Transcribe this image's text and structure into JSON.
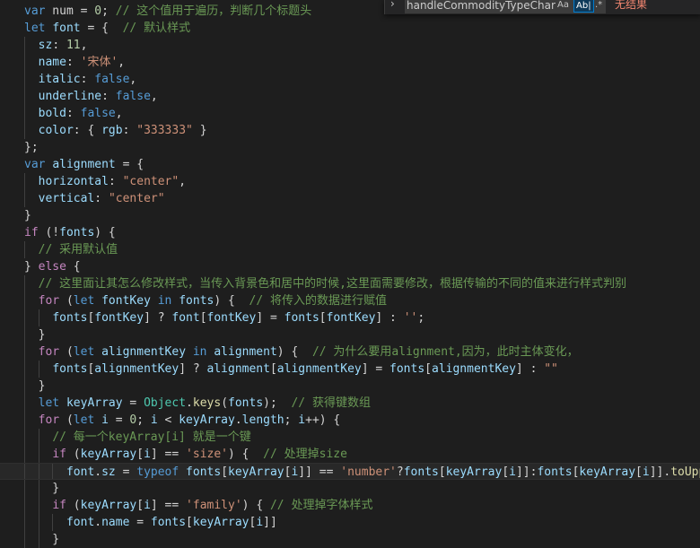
{
  "colors": {
    "background": "#1e1e1e",
    "keyword": "#569cd6",
    "control": "#c586c0",
    "variable": "#9cdcfe",
    "number": "#b5cea8",
    "string": "#ce9178",
    "comment": "#6a9955",
    "function": "#dcdcaa",
    "class": "#4ec9b0",
    "no_results": "#f48771"
  },
  "find_widget": {
    "toggle_icon": "chevron-right-icon",
    "query": "handleCommodityTypeChar",
    "match_case_label": "Aa",
    "whole_word_label": "Ab|",
    "regex_label": ".*",
    "result_text": "无结果"
  },
  "editor": {
    "lines": [
      [
        [
          "kw",
          "var"
        ],
        [
          "p",
          " num = "
        ],
        [
          "n",
          "0"
        ],
        [
          "p",
          "; "
        ],
        [
          "c",
          "// 这个值用于遍历，判断几个标题头"
        ]
      ],
      [
        [
          "kw",
          "let"
        ],
        [
          "p",
          " "
        ],
        [
          "v",
          "font"
        ],
        [
          "p",
          " = {  "
        ],
        [
          "c",
          "// 默认样式"
        ]
      ],
      [
        [
          "p",
          "  "
        ],
        [
          "v",
          "sz"
        ],
        [
          "p",
          ": "
        ],
        [
          "n",
          "11"
        ],
        [
          "p",
          ","
        ]
      ],
      [
        [
          "p",
          "  "
        ],
        [
          "v",
          "name"
        ],
        [
          "p",
          ": "
        ],
        [
          "s",
          "'宋体'"
        ],
        [
          "p",
          ","
        ]
      ],
      [
        [
          "p",
          "  "
        ],
        [
          "v",
          "italic"
        ],
        [
          "p",
          ": "
        ],
        [
          "kw",
          "false"
        ],
        [
          "p",
          ","
        ]
      ],
      [
        [
          "p",
          "  "
        ],
        [
          "v",
          "underline"
        ],
        [
          "p",
          ": "
        ],
        [
          "kw",
          "false"
        ],
        [
          "p",
          ","
        ]
      ],
      [
        [
          "p",
          "  "
        ],
        [
          "v",
          "bold"
        ],
        [
          "p",
          ": "
        ],
        [
          "kw",
          "false"
        ],
        [
          "p",
          ","
        ]
      ],
      [
        [
          "p",
          "  "
        ],
        [
          "v",
          "color"
        ],
        [
          "p",
          ": { "
        ],
        [
          "v",
          "rgb"
        ],
        [
          "p",
          ": "
        ],
        [
          "s",
          "\"333333\""
        ],
        [
          "p",
          " }"
        ]
      ],
      [
        [
          "p",
          "};"
        ]
      ],
      [
        [
          "kw",
          "var"
        ],
        [
          "p",
          " "
        ],
        [
          "v",
          "alignment"
        ],
        [
          "p",
          " = {"
        ]
      ],
      [
        [
          "p",
          "  "
        ],
        [
          "v",
          "horizontal"
        ],
        [
          "p",
          ": "
        ],
        [
          "s",
          "\"center\""
        ],
        [
          "p",
          ","
        ]
      ],
      [
        [
          "p",
          "  "
        ],
        [
          "v",
          "vertical"
        ],
        [
          "p",
          ": "
        ],
        [
          "s",
          "\"center\""
        ]
      ],
      [
        [
          "p",
          "}"
        ]
      ],
      [
        [
          "ct",
          "if"
        ],
        [
          "p",
          " (!"
        ],
        [
          "v",
          "fonts"
        ],
        [
          "p",
          ") {"
        ]
      ],
      [
        [
          "p",
          "  "
        ],
        [
          "c",
          "// 采用默认值"
        ]
      ],
      [
        [
          "p",
          "} "
        ],
        [
          "ct",
          "else"
        ],
        [
          "p",
          " {"
        ]
      ],
      [
        [
          "p",
          "  "
        ],
        [
          "c",
          "// 这里面让其怎么修改样式，当传入背景色和居中的时候,这里面需要修改，根据传输的不同的值来进行样式判别"
        ]
      ],
      [
        [
          "p",
          "  "
        ],
        [
          "ct",
          "for"
        ],
        [
          "p",
          " ("
        ],
        [
          "kw",
          "let"
        ],
        [
          "p",
          " "
        ],
        [
          "v",
          "fontKey"
        ],
        [
          "p",
          " "
        ],
        [
          "kw",
          "in"
        ],
        [
          "p",
          " "
        ],
        [
          "v",
          "fonts"
        ],
        [
          "p",
          ") {  "
        ],
        [
          "c",
          "// 将传入的数据进行赋值"
        ]
      ],
      [
        [
          "p",
          "    "
        ],
        [
          "v",
          "fonts"
        ],
        [
          "p",
          "["
        ],
        [
          "v",
          "fontKey"
        ],
        [
          "p",
          "] ? "
        ],
        [
          "v",
          "font"
        ],
        [
          "p",
          "["
        ],
        [
          "v",
          "fontKey"
        ],
        [
          "p",
          "] = "
        ],
        [
          "v",
          "fonts"
        ],
        [
          "p",
          "["
        ],
        [
          "v",
          "fontKey"
        ],
        [
          "p",
          "] : "
        ],
        [
          "s",
          "''"
        ],
        [
          "p",
          ";"
        ]
      ],
      [
        [
          "p",
          "  }"
        ]
      ],
      [
        [
          "p",
          "  "
        ],
        [
          "ct",
          "for"
        ],
        [
          "p",
          " ("
        ],
        [
          "kw",
          "let"
        ],
        [
          "p",
          " "
        ],
        [
          "v",
          "alignmentKey"
        ],
        [
          "p",
          " "
        ],
        [
          "kw",
          "in"
        ],
        [
          "p",
          " "
        ],
        [
          "v",
          "alignment"
        ],
        [
          "p",
          ") {  "
        ],
        [
          "c",
          "// 为什么要用alignment,因为，此时主体变化，"
        ]
      ],
      [
        [
          "p",
          "    "
        ],
        [
          "v",
          "fonts"
        ],
        [
          "p",
          "["
        ],
        [
          "v",
          "alignmentKey"
        ],
        [
          "p",
          "] ? "
        ],
        [
          "v",
          "alignment"
        ],
        [
          "p",
          "["
        ],
        [
          "v",
          "alignmentKey"
        ],
        [
          "p",
          "] = "
        ],
        [
          "v",
          "fonts"
        ],
        [
          "p",
          "["
        ],
        [
          "v",
          "alignmentKey"
        ],
        [
          "p",
          "] : "
        ],
        [
          "s",
          "\"\""
        ]
      ],
      [
        [
          "p",
          "  }"
        ]
      ],
      [
        [
          "p",
          "  "
        ],
        [
          "kw",
          "let"
        ],
        [
          "p",
          " "
        ],
        [
          "v",
          "keyArray"
        ],
        [
          "p",
          " = "
        ],
        [
          "cl",
          "Object"
        ],
        [
          "p",
          "."
        ],
        [
          "f",
          "keys"
        ],
        [
          "p",
          "("
        ],
        [
          "v",
          "fonts"
        ],
        [
          "p",
          ");  "
        ],
        [
          "c",
          "// 获得键数组"
        ]
      ],
      [
        [
          "p",
          "  "
        ],
        [
          "ct",
          "for"
        ],
        [
          "p",
          " ("
        ],
        [
          "kw",
          "let"
        ],
        [
          "p",
          " "
        ],
        [
          "v",
          "i"
        ],
        [
          "p",
          " = "
        ],
        [
          "n",
          "0"
        ],
        [
          "p",
          "; "
        ],
        [
          "v",
          "i"
        ],
        [
          "p",
          " < "
        ],
        [
          "v",
          "keyArray"
        ],
        [
          "p",
          "."
        ],
        [
          "v",
          "length"
        ],
        [
          "p",
          "; "
        ],
        [
          "v",
          "i"
        ],
        [
          "p",
          "++) {"
        ]
      ],
      [
        [
          "p",
          "    "
        ],
        [
          "c",
          "// 每一个keyArray[i] 就是一个键"
        ]
      ],
      [
        [
          "p",
          "    "
        ],
        [
          "ct",
          "if"
        ],
        [
          "p",
          " ("
        ],
        [
          "v",
          "keyArray"
        ],
        [
          "p",
          "["
        ],
        [
          "v",
          "i"
        ],
        [
          "p",
          "] == "
        ],
        [
          "s",
          "'size'"
        ],
        [
          "p",
          ") {  "
        ],
        [
          "c",
          "// 处理掉size"
        ]
      ],
      [
        [
          "p",
          "      "
        ],
        [
          "v",
          "font"
        ],
        [
          "p",
          "."
        ],
        [
          "v",
          "sz"
        ],
        [
          "p",
          " = "
        ],
        [
          "kw",
          "typeof"
        ],
        [
          "p",
          " "
        ],
        [
          "v",
          "fonts"
        ],
        [
          "p",
          "["
        ],
        [
          "v",
          "keyArray"
        ],
        [
          "p",
          "["
        ],
        [
          "v",
          "i"
        ],
        [
          "p",
          "]] == "
        ],
        [
          "s",
          "'number'"
        ],
        [
          "p",
          "?"
        ],
        [
          "v",
          "fonts"
        ],
        [
          "p",
          "["
        ],
        [
          "v",
          "keyArray"
        ],
        [
          "p",
          "["
        ],
        [
          "v",
          "i"
        ],
        [
          "p",
          "]]:"
        ],
        [
          "v",
          "fonts"
        ],
        [
          "p",
          "["
        ],
        [
          "v",
          "keyArray"
        ],
        [
          "p",
          "["
        ],
        [
          "v",
          "i"
        ],
        [
          "p",
          "]]."
        ],
        [
          "f",
          "toUpperCase"
        ]
      ],
      [
        [
          "p",
          "    }"
        ]
      ],
      [
        [
          "p",
          "    "
        ],
        [
          "ct",
          "if"
        ],
        [
          "p",
          " ("
        ],
        [
          "v",
          "keyArray"
        ],
        [
          "p",
          "["
        ],
        [
          "v",
          "i"
        ],
        [
          "p",
          "] == "
        ],
        [
          "s",
          "'family'"
        ],
        [
          "p",
          ") { "
        ],
        [
          "c",
          "// 处理掉字体样式"
        ]
      ],
      [
        [
          "p",
          "      "
        ],
        [
          "v",
          "font"
        ],
        [
          "p",
          "."
        ],
        [
          "v",
          "name"
        ],
        [
          "p",
          " = "
        ],
        [
          "v",
          "fonts"
        ],
        [
          "p",
          "["
        ],
        [
          "v",
          "keyArray"
        ],
        [
          "p",
          "["
        ],
        [
          "v",
          "i"
        ],
        [
          "p",
          "]]"
        ]
      ],
      [
        [
          "p",
          "    }"
        ]
      ]
    ]
  }
}
